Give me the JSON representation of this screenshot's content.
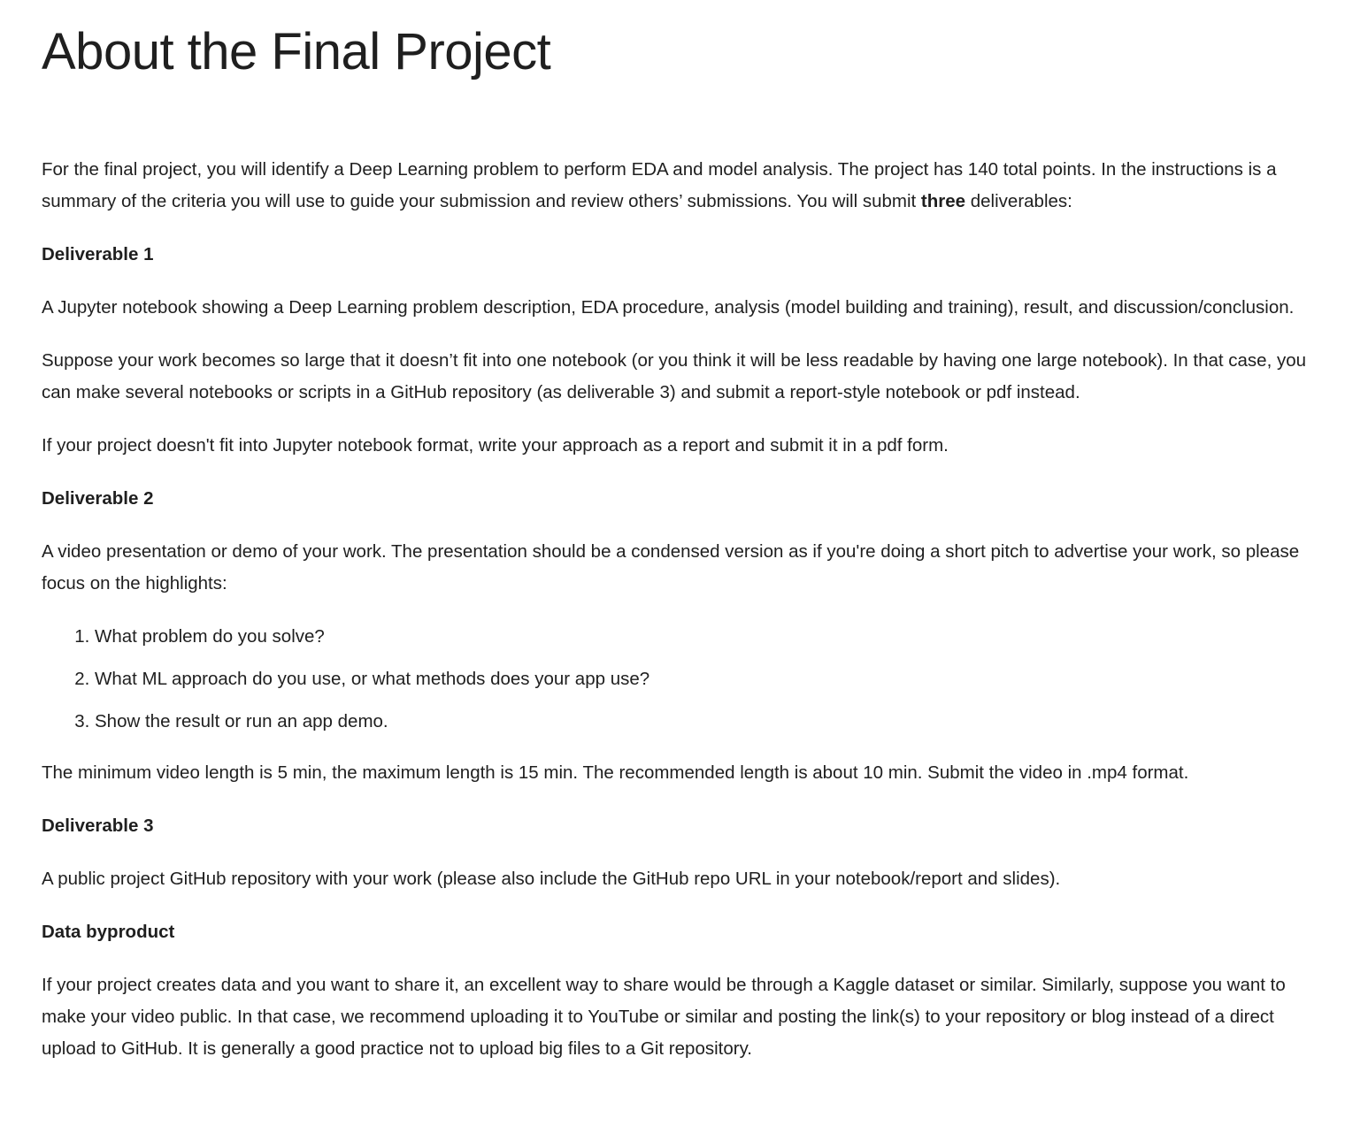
{
  "page": {
    "title": "About the Final Project"
  },
  "intro": {
    "text_before": "For the final project, you will identify a Deep Learning problem to perform EDA and model analysis.  The project has 140 total points. In the instructions is a summary of the criteria you will use to guide your submission and review others’ submissions.   You will submit ",
    "bold": "three",
    "text_after": " deliverables:"
  },
  "deliverable1": {
    "heading": "Deliverable 1",
    "paragraphs": [
      "A Jupyter notebook showing a Deep Learning problem description, EDA procedure, analysis (model building and training), result, and discussion/conclusion.",
      "Suppose your work becomes so large that it doesn’t fit into one notebook (or you think it will be less readable by having one large notebook). In that case, you can make several notebooks or scripts in a GitHub repository (as deliverable 3) and submit a report-style notebook or pdf instead.",
      "If your project doesn't fit into Jupyter notebook format, write your approach as a report and submit it in a pdf form."
    ]
  },
  "deliverable2": {
    "heading": "Deliverable 2",
    "intro": "A video presentation or demo of your work. The presentation should be a condensed version as if you're doing a short pitch to advertise your work, so please focus on the highlights:",
    "items": [
      "What problem do you solve?",
      "What ML approach do you use, or what methods does your app use?",
      "Show the result or run an app demo."
    ],
    "outro": "The minimum video length is 5 min, the maximum length is 15 min. The recommended length is about 10 min. Submit the video in .mp4 format."
  },
  "deliverable3": {
    "heading": "Deliverable 3",
    "text": "A public project GitHub repository with your work (please also include the GitHub repo URL in your notebook/report and slides)."
  },
  "byproduct": {
    "heading": "Data byproduct",
    "text": "If your project creates data and you want to share it, an excellent way to share would be through a Kaggle dataset or similar. Similarly, suppose you want to make your video public. In that case, we recommend uploading it to YouTube or similar and posting the link(s) to your repository or blog instead of a direct upload to GitHub. It is generally a good practice not to upload big files to a Git repository."
  }
}
